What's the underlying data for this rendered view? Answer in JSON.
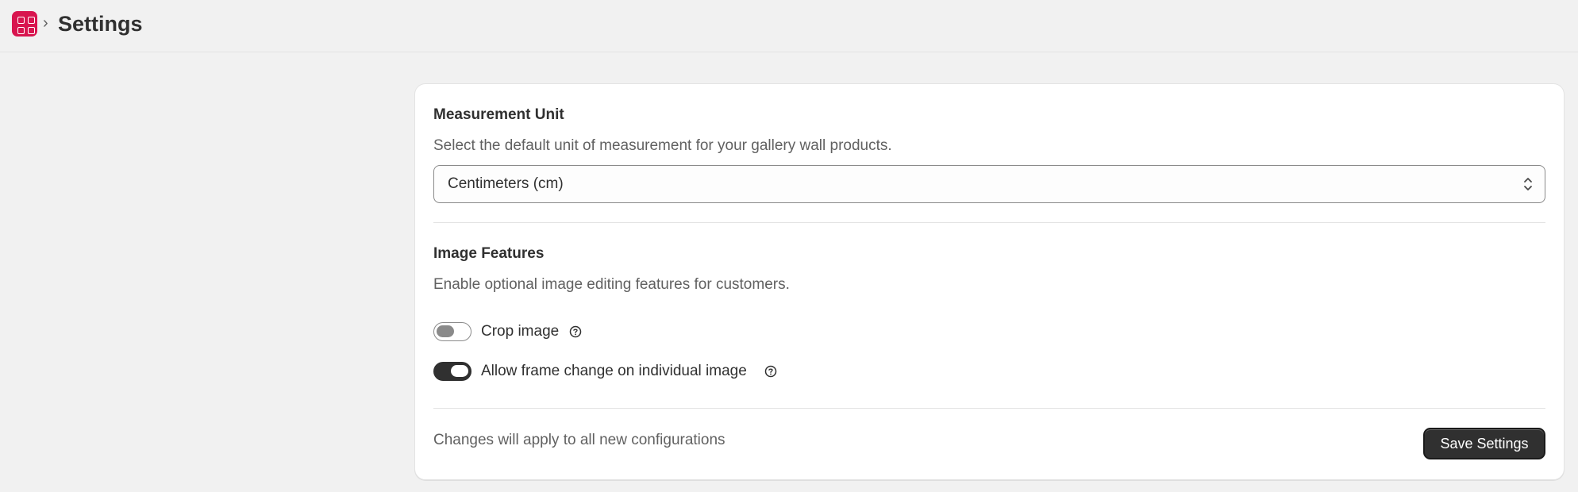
{
  "header": {
    "app_icon": "app-grid-icon",
    "breadcrumb_separator_icon": "chevron-right-icon",
    "title": "Settings",
    "accent_color": "#d8154f"
  },
  "measurement": {
    "title": "Measurement Unit",
    "description": "Select the default unit of measurement for your gallery wall products.",
    "select_value": "Centimeters (cm)",
    "select_icon": "chevron-up-down-icon"
  },
  "image_features": {
    "title": "Image Features",
    "description": "Enable optional image editing features for customers.",
    "toggles": [
      {
        "label": "Crop image",
        "enabled": false,
        "help_icon": "question-circle-icon"
      },
      {
        "label": "Allow frame change on individual image",
        "enabled": true,
        "help_icon": "question-circle-icon"
      }
    ]
  },
  "footer": {
    "note": "Changes will apply to all new configurations",
    "save_label": "Save Settings"
  }
}
